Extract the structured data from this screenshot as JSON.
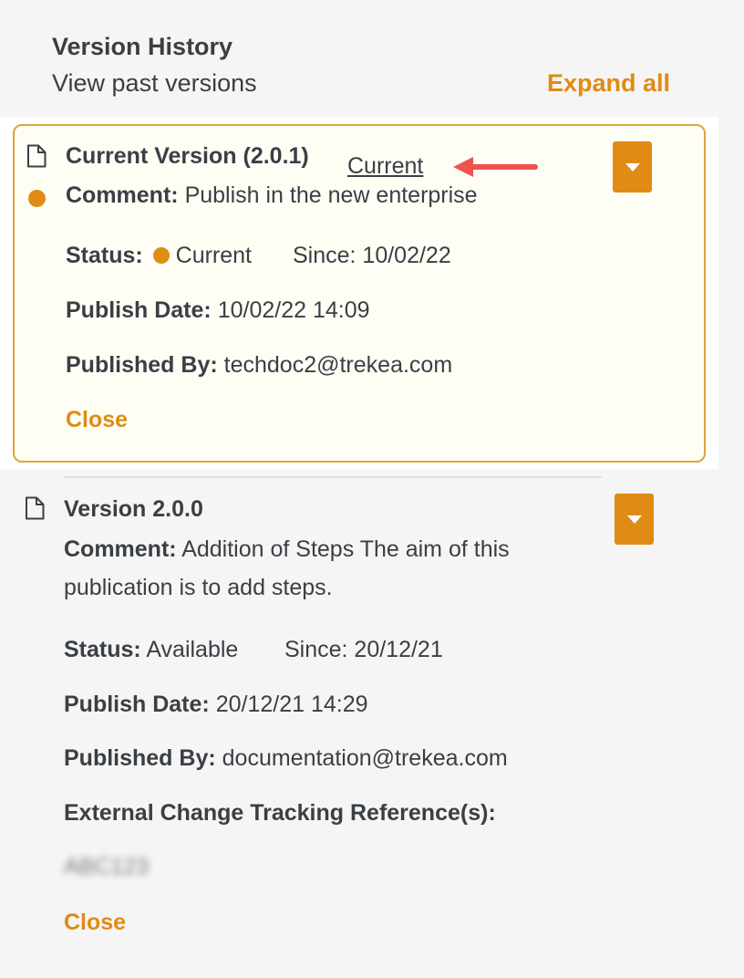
{
  "header": {
    "title": "Version History",
    "subtitle": "View past versions",
    "expand_all": "Expand all"
  },
  "versions": [
    {
      "title": "Current Version (2.0.1)",
      "badge": "Current",
      "comment_label": "Comment:",
      "comment": "Publish in the new enterprise",
      "status_label": "Status:",
      "status": "Current",
      "since": "Since: 10/02/22",
      "publish_date_label": "Publish Date:",
      "publish_date": "10/02/22 14:09",
      "published_by_label": "Published By:",
      "published_by": "techdoc2@trekea.com",
      "close": "Close"
    },
    {
      "title": "Version 2.0.0",
      "comment_label": "Comment:",
      "comment_line1": "Addition of Steps The aim of this",
      "comment_line2": "publication is to add steps.",
      "status_label": "Status:",
      "status": "Available",
      "since": "Since: 20/12/21",
      "publish_date_label": "Publish Date:",
      "publish_date": "20/12/21 14:29",
      "published_by_label": "Published By:",
      "published_by": "documentation@trekea.com",
      "ext_ref_label": "External Change Tracking Reference(s):",
      "ext_ref_value": "ABC123",
      "close": "Close"
    }
  ],
  "colors": {
    "accent": "#e08b14",
    "card_border": "#e3a23c",
    "annotation_arrow": "#f0524f",
    "text": "#3a3f44"
  }
}
